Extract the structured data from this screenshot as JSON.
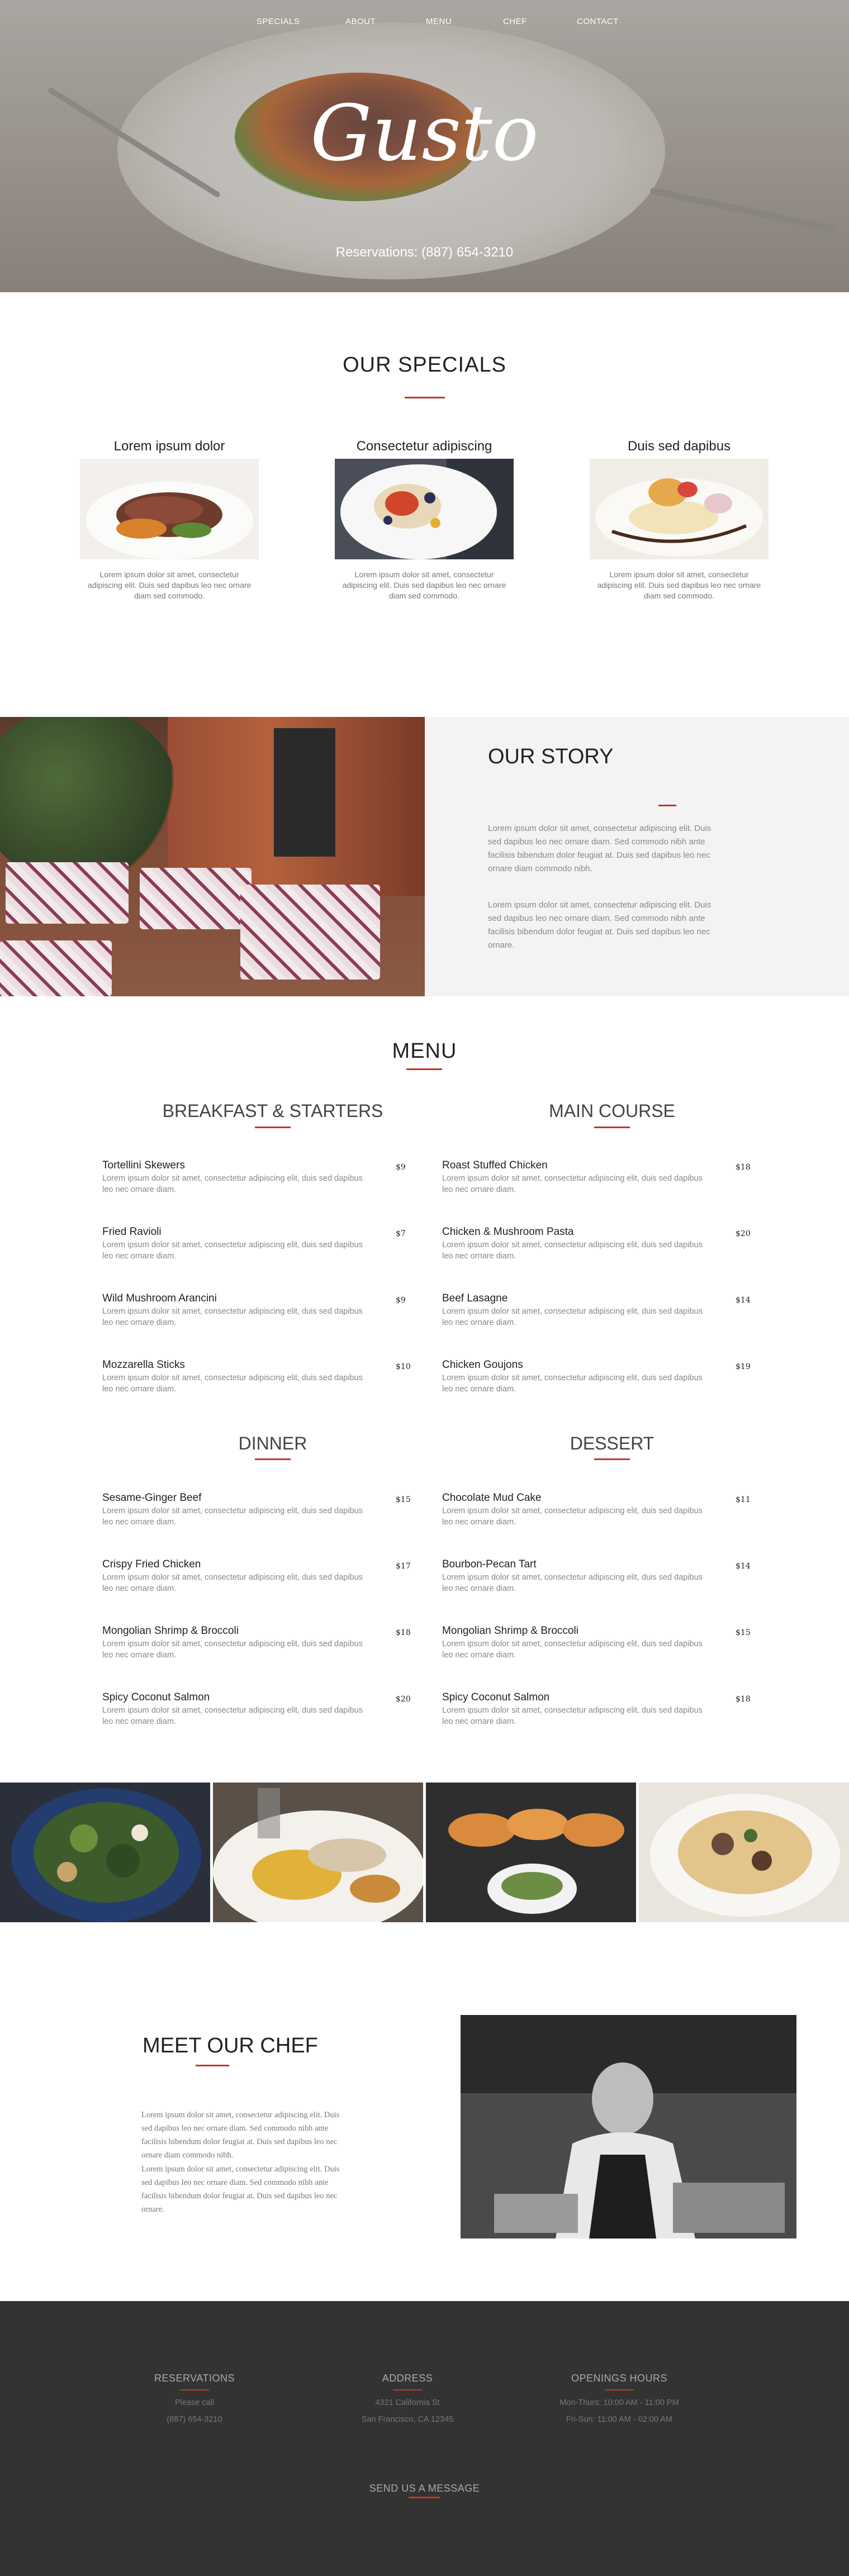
{
  "nav": {
    "items": [
      "SPECIALS",
      "ABOUT",
      "MENU",
      "CHEF",
      "CONTACT"
    ]
  },
  "hero": {
    "logo": "Gusto",
    "reservation": "Reservations: (887) 654-3210"
  },
  "specials": {
    "title": "OUR SPECIALS",
    "items": [
      {
        "title": "Lorem ipsum dolor",
        "text": "Lorem ipsum dolor sit amet, consectetur adipiscing elit. Duis sed dapibus leo nec ornare diam sed commodo."
      },
      {
        "title": "Consectetur adipiscing",
        "text": "Lorem ipsum dolor sit amet, consectetur adipiscing elit. Duis sed dapibus leo nec ornare diam sed commodo."
      },
      {
        "title": "Duis sed dapibus",
        "text": "Lorem ipsum dolor sit amet, consectetur adipiscing elit. Duis sed dapibus leo nec ornare diam sed commodo."
      }
    ]
  },
  "story": {
    "title": "OUR STORY",
    "p1": "Lorem ipsum dolor sit amet, consectetur adipiscing elit. Duis sed dapibus leo nec ornare diam. Sed commodo nibh ante facilisis bibendum dolor feugiat at. Duis sed dapibus leo nec ornare diam commodo nibh.",
    "p2": "Lorem ipsum dolor sit amet, consectetur adipiscing elit. Duis sed dapibus leo nec ornare diam. Sed commodo nibh ante facilisis bibendum dolor feugiat at. Duis sed dapibus leo nec ornare."
  },
  "menu": {
    "title": "MENU",
    "categories": [
      {
        "name": "BREAKFAST & STARTERS",
        "items": [
          {
            "name": "Tortellini Skewers",
            "desc": "Lorem ipsum dolor sit amet, consectetur adipiscing elit, duis sed dapibus leo nec ornare diam.",
            "price": "$9"
          },
          {
            "name": "Fried Ravioli",
            "desc": "Lorem ipsum dolor sit amet, consectetur adipiscing elit, duis sed dapibus leo nec ornare diam.",
            "price": "$7"
          },
          {
            "name": "Wild Mushroom Arancini",
            "desc": "Lorem ipsum dolor sit amet, consectetur adipiscing elit, duis sed dapibus leo nec ornare diam.",
            "price": "$9"
          },
          {
            "name": "Mozzarella Sticks",
            "desc": "Lorem ipsum dolor sit amet, consectetur adipiscing elit, duis sed dapibus leo nec ornare diam.",
            "price": "$10"
          }
        ]
      },
      {
        "name": "MAIN COURSE",
        "items": [
          {
            "name": "Roast Stuffed Chicken",
            "desc": "Lorem ipsum dolor sit amet, consectetur adipiscing elit, duis sed dapibus leo nec ornare diam.",
            "price": "$18"
          },
          {
            "name": "Chicken & Mushroom Pasta",
            "desc": "Lorem ipsum dolor sit amet, consectetur adipiscing elit, duis sed dapibus leo nec ornare diam.",
            "price": "$20"
          },
          {
            "name": "Beef Lasagne",
            "desc": "Lorem ipsum dolor sit amet, consectetur adipiscing elit, duis sed dapibus leo nec ornare diam.",
            "price": "$14"
          },
          {
            "name": "Chicken Goujons",
            "desc": "Lorem ipsum dolor sit amet, consectetur adipiscing elit, duis sed dapibus leo nec ornare diam.",
            "price": "$19"
          }
        ]
      },
      {
        "name": "DINNER",
        "items": [
          {
            "name": "Sesame-Ginger Beef",
            "desc": "Lorem ipsum dolor sit amet, consectetur adipiscing elit, duis sed dapibus leo nec ornare diam.",
            "price": "$15"
          },
          {
            "name": "Crispy Fried Chicken",
            "desc": "Lorem ipsum dolor sit amet, consectetur adipiscing elit, duis sed dapibus leo nec ornare diam.",
            "price": "$17"
          },
          {
            "name": "Mongolian Shrimp & Broccoli",
            "desc": "Lorem ipsum dolor sit amet, consectetur adipiscing elit, duis sed dapibus leo nec ornare diam.",
            "price": "$18"
          },
          {
            "name": "Spicy Coconut Salmon",
            "desc": "Lorem ipsum dolor sit amet, consectetur adipiscing elit, duis sed dapibus leo nec ornare diam.",
            "price": "$20"
          }
        ]
      },
      {
        "name": "DESSERT",
        "items": [
          {
            "name": "Chocolate Mud Cake",
            "desc": "Lorem ipsum dolor sit amet, consectetur adipiscing elit, duis sed dapibus leo nec ornare diam.",
            "price": "$11"
          },
          {
            "name": "Bourbon-Pecan Tart",
            "desc": "Lorem ipsum dolor sit amet, consectetur adipiscing elit, duis sed dapibus leo nec ornare diam.",
            "price": "$14"
          },
          {
            "name": "Mongolian Shrimp & Broccoli",
            "desc": "Lorem ipsum dolor sit amet, consectetur adipiscing elit, duis sed dapibus leo nec ornare diam.",
            "price": "$15"
          },
          {
            "name": "Spicy Coconut Salmon",
            "desc": "Lorem ipsum dolor sit amet, consectetur adipiscing elit, duis sed dapibus leo nec ornare diam.",
            "price": "$18"
          }
        ]
      }
    ]
  },
  "chef": {
    "title": "MEET OUR CHEF",
    "p1": "Lorem ipsum dolor sit amet, consectetur adipiscing elit. Duis sed dapibus leo nec ornare diam. Sed commodo nibh ante facilisis bibendum dolor feugiat at. Duis sed dapibus leo nec ornare diam commodo nibh.",
    "p2": "Lorem ipsum dolor sit amet, consectetur adipiscing elit. Duis sed dapibus leo nec ornare diam. Sed commodo nibh ante facilisis bibendum dolor feugiat at. Duis sed dapibus leo nec ornare."
  },
  "footer": {
    "reservations": {
      "title": "RESERVATIONS",
      "line1": "Please call",
      "line2": "(887) 654-3210"
    },
    "address": {
      "title": "ADDRESS",
      "line1": "4321 California St",
      "line2": "San Francisco, CA 12345"
    },
    "hours": {
      "title": "OPENINGS HOURS",
      "line1": "Mon-Thurs: 10:00 AM - 11:00 PM",
      "line2": "Fri-Sun: 11:00 AM - 02:00 AM"
    },
    "send_message": "SEND US A MESSAGE"
  },
  "colors": {
    "accent": "#c0392b",
    "footer_bg": "#333333",
    "story_bg": "#f3f3f3"
  }
}
